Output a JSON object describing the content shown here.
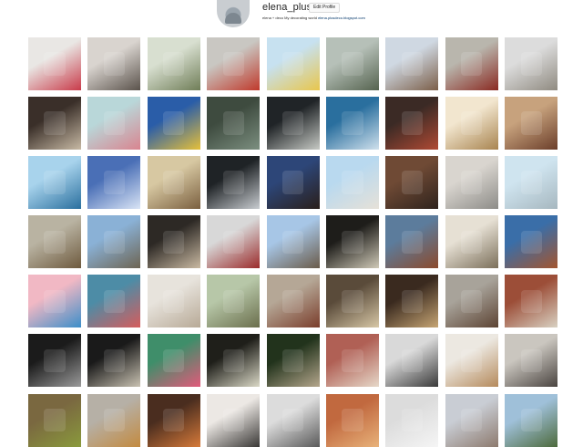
{
  "profile": {
    "username": "elena_plusdeco",
    "edit_label": "Edit Profile",
    "bio": "elena + deco My decorating world",
    "link": "elena.plusdeco.blogspot.com"
  },
  "tiles": [
    [
      "#e9e7e4",
      "#c93b4a"
    ],
    [
      "#d9d4cf",
      "#5a524b"
    ],
    [
      "#d8dfd0",
      "#6f7d57"
    ],
    [
      "#c9c7c2",
      "#c0392b"
    ],
    [
      "#c7e1f0",
      "#e8c64c"
    ],
    [
      "#b6c0b8",
      "#55634f"
    ],
    [
      "#cfd8e2",
      "#7b5e48"
    ],
    [
      "#b9b6ad",
      "#8a2a22"
    ],
    [
      "#dcdcdc",
      "#8f8a80"
    ],
    [
      "#3a2f29",
      "#c7b9a4"
    ],
    [
      "#b9d7d9",
      "#d9848f"
    ],
    [
      "#2a5da8",
      "#e5c03a"
    ],
    [
      "#3e4b3f",
      "#7c8f80"
    ],
    [
      "#202427",
      "#c6c9c4"
    ],
    [
      "#2a6f9e",
      "#cfe0ec"
    ],
    [
      "#3b2a25",
      "#b04a34"
    ],
    [
      "#f2e6cf",
      "#a88450"
    ],
    [
      "#c7a27d",
      "#6b3e2a"
    ],
    [
      "#a8d3ec",
      "#2a6f9e"
    ],
    [
      "#4a6fb6",
      "#d9e4f5"
    ],
    [
      "#d7c8a2",
      "#7a5f3f"
    ],
    [
      "#1f2326",
      "#c8ccd0"
    ],
    [
      "#2d4678",
      "#2a1f1a"
    ],
    [
      "#b9d9ef",
      "#e6e1d8"
    ],
    [
      "#6f4a35",
      "#2f231d"
    ],
    [
      "#d9d5cf",
      "#8d8c88"
    ],
    [
      "#cfe4ef",
      "#a6b7bf"
    ],
    [
      "#b9b3a2",
      "#6e5a3e"
    ],
    [
      "#8ab1d6",
      "#6d6452"
    ],
    [
      "#2d2925",
      "#c9b9a2"
    ],
    [
      "#d8d8d8",
      "#9b2b2b"
    ],
    [
      "#a7c6e6",
      "#6a5b4a"
    ],
    [
      "#1e1d1a",
      "#cfc9b7"
    ],
    [
      "#5c7c9c",
      "#8b4a2c"
    ],
    [
      "#e6e0d4",
      "#7b6f5a"
    ],
    [
      "#3a6ea8",
      "#a3552f"
    ],
    [
      "#f1b8c4",
      "#3c8ec9"
    ],
    [
      "#4d8ca6",
      "#d65c5c"
    ],
    [
      "#e7e3dc",
      "#b7a996"
    ],
    [
      "#b7c7a8",
      "#6a6e4c"
    ],
    [
      "#b5a796",
      "#7a3d2b"
    ],
    [
      "#5a4b3a",
      "#d7c7a6"
    ],
    [
      "#3a2a1f",
      "#c6a574"
    ],
    [
      "#a8a39a",
      "#5c4333"
    ],
    [
      "#9c4e38",
      "#d8d1c2"
    ],
    [
      "#1b1b1b",
      "#9a9a9a"
    ],
    [
      "#1a1a1a",
      "#c9c2b2"
    ],
    [
      "#3f8e6a",
      "#e15a7a"
    ],
    [
      "#1f1f1a",
      "#dad8c6"
    ],
    [
      "#22331c",
      "#b4a68c"
    ],
    [
      "#b06055",
      "#e6d8c9"
    ],
    [
      "#d9d9d9",
      "#3a3a3a"
    ],
    [
      "#ece8e1",
      "#b58a5c"
    ],
    [
      "#cac6bf",
      "#4a4440"
    ],
    [
      "#7a6840",
      "#8a9a3c"
    ],
    [
      "#b6b0a6",
      "#c38a3f"
    ],
    [
      "#4a2d1f",
      "#d67a3a"
    ],
    [
      "#ece8e4",
      "#3a3836"
    ],
    [
      "#dcdcdc",
      "#5a5a5a"
    ],
    [
      "#c1693f",
      "#e8b27a"
    ],
    [
      "#dcdcdc",
      "#f5f5f5"
    ],
    [
      "#c9cdd4",
      "#8d7a6e"
    ],
    [
      "#9fc0d9",
      "#4d6a3c"
    ]
  ]
}
